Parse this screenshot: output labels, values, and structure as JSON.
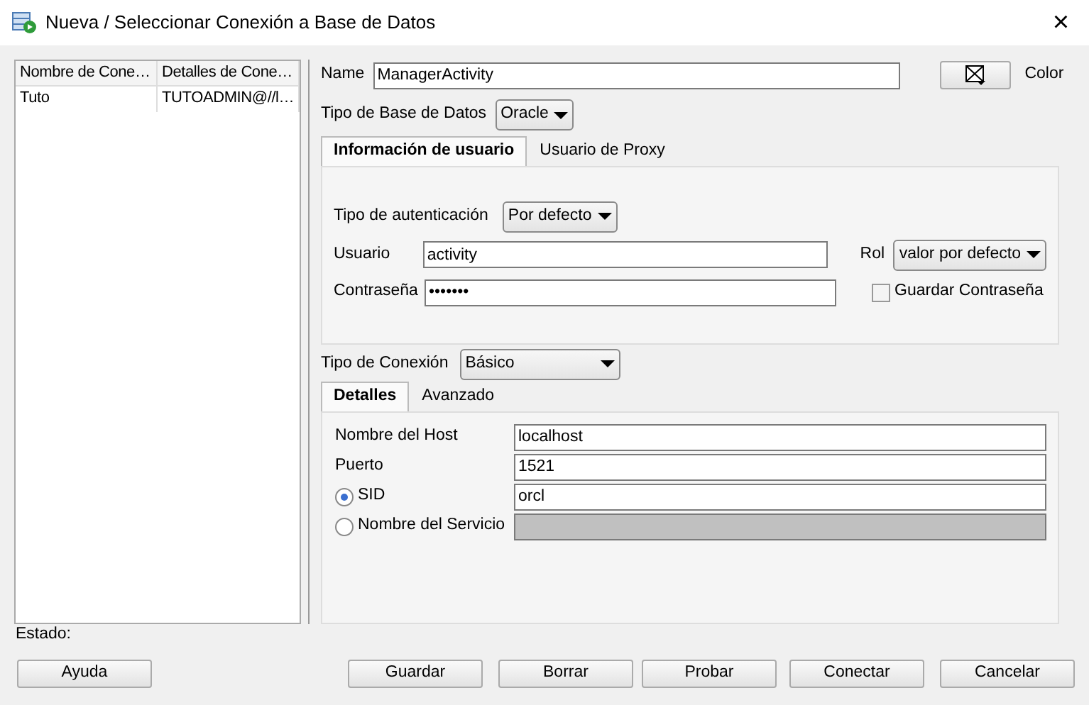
{
  "window": {
    "title": "Nueva / Seleccionar Conexión a Base de Datos",
    "close": "×"
  },
  "connections": {
    "columns": [
      "Nombre de Cone…",
      "Detalles de Cone…"
    ],
    "rows": [
      {
        "cells": [
          "Tuto",
          "TUTOADMIN@//l…"
        ]
      }
    ]
  },
  "name": {
    "label": "Name",
    "value": "ManagerActivity"
  },
  "color": {
    "label": "Color"
  },
  "db_type": {
    "label": "Tipo de Base de Datos",
    "value": "Oracle"
  },
  "user_tabs": [
    {
      "label": "Información de usuario",
      "selected": true
    },
    {
      "label": "Usuario de Proxy",
      "selected": false
    }
  ],
  "auth": {
    "label": "Tipo de autenticación",
    "value": "Por defecto"
  },
  "user": {
    "label": "Usuario",
    "value": "activity"
  },
  "password": {
    "label": "Contraseña",
    "value": "•••••••"
  },
  "role": {
    "label": "Rol",
    "value": "valor por defecto"
  },
  "save_password": {
    "label": "Guardar Contraseña",
    "checked": false
  },
  "conn_type": {
    "label": "Tipo de Conexión",
    "value": "Básico"
  },
  "conn_tabs": [
    {
      "label": "Detalles",
      "selected": true
    },
    {
      "label": "Avanzado",
      "selected": false
    }
  ],
  "fields": [
    {
      "kind": "text",
      "label": "Nombre del Host",
      "value": "localhost"
    },
    {
      "kind": "text",
      "label": "Puerto",
      "value": "1521"
    },
    {
      "kind": "radio",
      "label": "SID",
      "value": "orcl",
      "selected": true,
      "disabled": false
    },
    {
      "kind": "radio",
      "label": "Nombre del Servicio",
      "selected": false,
      "disabled": true
    }
  ],
  "status": {
    "label": "Estado:"
  },
  "help_button": "Ayuda",
  "buttons": [
    "Guardar",
    "Borrar",
    "Probar",
    "Conectar",
    "Cancelar"
  ]
}
